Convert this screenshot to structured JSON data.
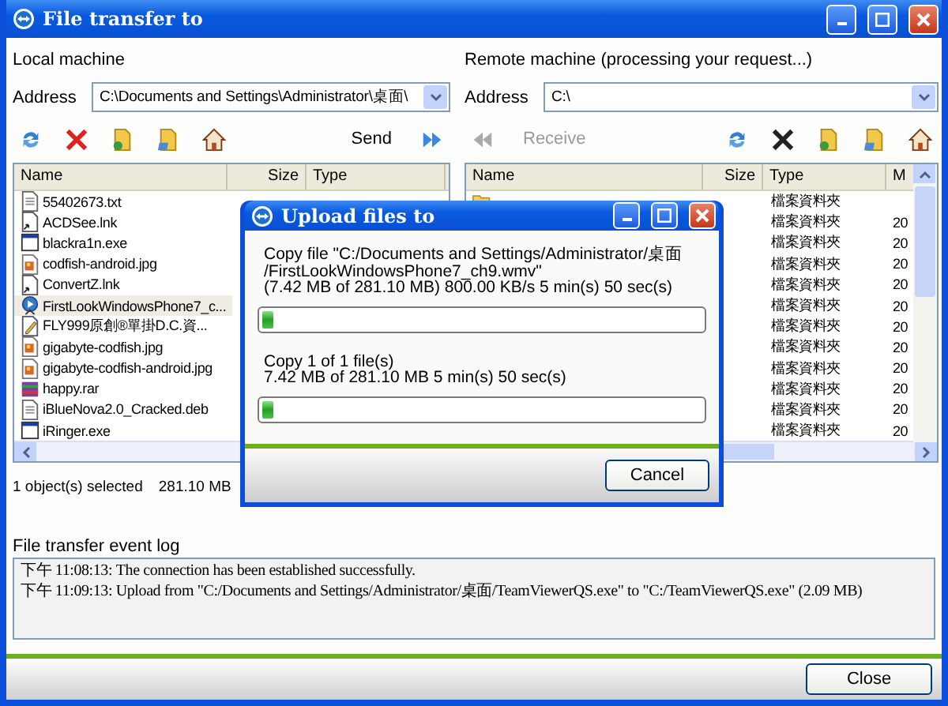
{
  "window": {
    "title": "File transfer to"
  },
  "local": {
    "label": "Local machine",
    "address_label": "Address",
    "address": "C:\\Documents and Settings\\Administrator\\桌面\\",
    "send": "Send",
    "columns": [
      "Name",
      "Size",
      "Type"
    ],
    "files": [
      {
        "name": "55402673.txt",
        "kind": "text",
        "selected": false
      },
      {
        "name": "ACDSee.lnk",
        "kind": "link",
        "selected": false
      },
      {
        "name": "blackra1n.exe",
        "kind": "app",
        "selected": false
      },
      {
        "name": "codfish-android.jpg",
        "kind": "image",
        "selected": false
      },
      {
        "name": "ConvertZ.lnk",
        "kind": "link",
        "selected": false
      },
      {
        "name": "FirstLookWindowsPhone7_c...",
        "kind": "video",
        "selected": true
      },
      {
        "name": "FLY999原創®單掛D.C.資...",
        "kind": "doc",
        "selected": false
      },
      {
        "name": "gigabyte-codfish.jpg",
        "kind": "image",
        "selected": false
      },
      {
        "name": "gigabyte-codfish-android.jpg",
        "kind": "image",
        "selected": false
      },
      {
        "name": "happy.rar",
        "kind": "archive",
        "selected": false
      },
      {
        "name": "iBlueNova2.0_Cracked.deb",
        "kind": "text",
        "selected": false
      },
      {
        "name": "iRinger.exe",
        "kind": "app",
        "selected": false
      }
    ],
    "status": "1 object(s) selected",
    "status_size": "281.10 MB"
  },
  "remote": {
    "label": "Remote machine (processing your request...)",
    "address_label": "Address",
    "address": "C:\\",
    "receive": "Receive",
    "columns": [
      "Name",
      "Size",
      "Type",
      "M"
    ],
    "rows": [
      {
        "kind": "folder",
        "type": "檔案資料夾"
      },
      {
        "type": "檔案資料夾",
        "column_4": "20"
      },
      {
        "type": "檔案資料夾",
        "column_4": "20"
      },
      {
        "type": "檔案資料夾",
        "column_4": "20"
      },
      {
        "type": "檔案資料夾",
        "column_4": "20"
      },
      {
        "type": "檔案資料夾",
        "column_4": "20"
      },
      {
        "type": "檔案資料夾",
        "column_4": "20"
      },
      {
        "type": "檔案資料夾",
        "column_4": "20"
      },
      {
        "type": "檔案資料夾",
        "column_4": "20"
      },
      {
        "type": "檔案資料夾",
        "column_4": "20"
      },
      {
        "type": "檔案資料夾",
        "column_4": "20"
      },
      {
        "type": "檔案資料夾",
        "column_4": "20"
      }
    ]
  },
  "log": {
    "label": "File transfer event log",
    "entries": [
      "下午 11:08:13: The connection has been established successfully.",
      "下午 11:09:13: Upload from \"C:/Documents and Settings/Administrator/桌面/TeamViewerQS.exe\" to \"C:/TeamViewerQS.exe\" (2.09 MB)"
    ]
  },
  "close_button": "Close",
  "dialog": {
    "title": "Upload files to",
    "file_lines": [
      "Copy file \"C:/Documents and Settings/Administrator/桌面",
      "/FirstLookWindowsPhone7_ch9.wmv\"",
      " (7.42 MB of 281.10 MB)   800.00 KB/s  5 min(s) 50 sec(s)"
    ],
    "file_progress": {
      "level": 0.026
    },
    "total_lines": [
      "Copy 1 of 1 file(s)",
      "7.42 MB of 281.10 MB   5 min(s) 50 sec(s)"
    ],
    "total_progress": {
      "level": 0.026
    },
    "cancel": "Cancel"
  }
}
